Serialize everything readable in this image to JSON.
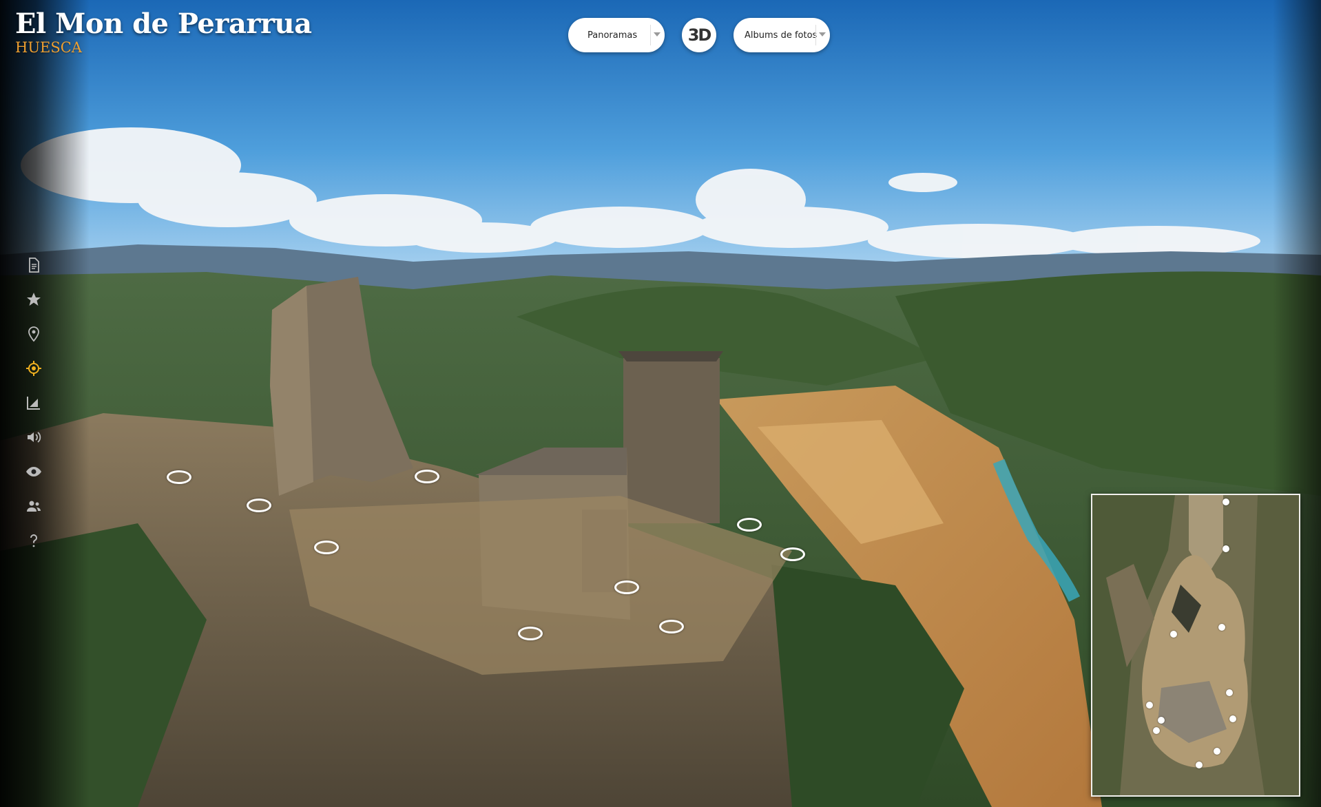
{
  "header": {
    "title": "El Mon de Perarrua",
    "subtitle": "HUESCA"
  },
  "toolbar": {
    "panoramas_label": "Panoramas",
    "three_d_label": "3D",
    "albums_label": "Albums de fotos"
  },
  "sidebar": {
    "items": [
      {
        "name": "document-icon"
      },
      {
        "name": "star-icon"
      },
      {
        "name": "map-pin-icon"
      },
      {
        "name": "target-icon",
        "active": true
      },
      {
        "name": "plan-icon"
      },
      {
        "name": "volume-icon"
      },
      {
        "name": "eye-icon"
      },
      {
        "name": "people-icon"
      },
      {
        "name": "help-icon"
      }
    ]
  },
  "colors": {
    "accent": "#f0a030",
    "icon": "#bbbbbb",
    "icon_active": "#f0b020"
  }
}
